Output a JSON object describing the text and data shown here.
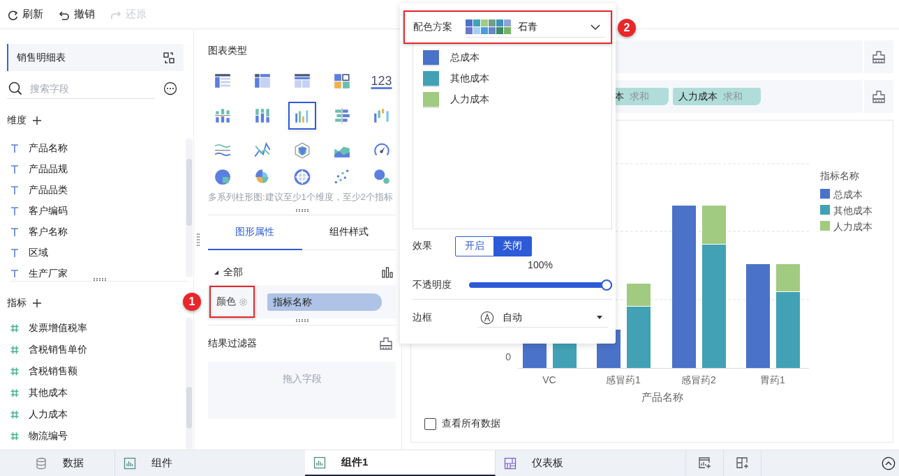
{
  "toolbar": [
    {
      "kind": "refresh",
      "label": "刷新",
      "disabled": false
    },
    {
      "kind": "undo",
      "label": "撤销",
      "disabled": false
    },
    {
      "kind": "redo",
      "label": "还原",
      "disabled": true
    }
  ],
  "data_panel": {
    "dataset": "销售明细表",
    "search": {
      "placeholder": "搜索字段"
    },
    "dimensions": {
      "title": "维度",
      "fields": [
        "产品名称",
        "产品品规",
        "产品品类",
        "客户编码",
        "客户名称",
        "区域",
        "生产厂家"
      ]
    },
    "measures": {
      "title": "指标",
      "fields": [
        "发票增值税率",
        "含税销售单价",
        "含税销售额",
        "其他成本",
        "人力成本",
        "物流编号"
      ]
    }
  },
  "chart_panel": {
    "title": "图表类型",
    "chart_types": [
      {
        "kind": "table",
        "selected": false
      },
      {
        "kind": "pivot",
        "selected": false
      },
      {
        "kind": "list",
        "selected": false
      },
      {
        "kind": "tiles",
        "selected": false
      },
      {
        "kind": "number",
        "label": "123",
        "selected": false
      },
      {
        "kind": "stacked",
        "selected": false
      },
      {
        "kind": "percent",
        "selected": false
      },
      {
        "kind": "column",
        "selected": true
      },
      {
        "kind": "mirror",
        "selected": false
      },
      {
        "kind": "waterfall",
        "selected": false
      },
      {
        "kind": "line",
        "selected": false
      },
      {
        "kind": "crossline",
        "selected": false
      },
      {
        "kind": "radar",
        "selected": false
      },
      {
        "kind": "area",
        "selected": false
      },
      {
        "kind": "gauge",
        "selected": false
      },
      {
        "kind": "pie",
        "selected": false
      },
      {
        "kind": "rose",
        "selected": false
      },
      {
        "kind": "ring",
        "selected": false
      },
      {
        "kind": "scatter",
        "selected": false
      },
      {
        "kind": "bubble",
        "selected": false
      }
    ],
    "description": "多系列柱形图:建议至少1个维度，至少2个指标",
    "tabs": [
      {
        "label": "图形属性",
        "selected": true
      },
      {
        "label": "组件样式",
        "selected": false
      }
    ],
    "group": {
      "label": "全部",
      "expanded": true
    },
    "color": {
      "label": "颜色",
      "field": "指标名称",
      "callout": "1"
    },
    "result_filter": {
      "title": "结果过滤器",
      "placeholder": "拖入字段"
    }
  },
  "measure_shelf": {
    "pills": [
      {
        "field": "本",
        "aggregation": "求和"
      },
      {
        "field": "人力成本",
        "aggregation": "求和"
      }
    ]
  },
  "chart": {
    "y_tick": "0",
    "categories": [
      "VC",
      "感冒药1",
      "感冒药2",
      "胃药1"
    ],
    "x_title": "产品名称",
    "legend": {
      "title": "指标名称",
      "items": [
        {
          "label": "总成本",
          "color": "#4a72c8"
        },
        {
          "label": "其他成本",
          "color": "#42a1b5"
        },
        {
          "label": "人力成本",
          "color": "#a1cb80"
        }
      ]
    },
    "view_all": {
      "label": "查看所有数据",
      "checked": false
    }
  },
  "color_popup": {
    "label": "配色方案",
    "scheme": "石青",
    "callout": "2",
    "palette": [
      {
        "color": "#4a72c8"
      },
      {
        "color": "#42a1b5"
      },
      {
        "color": "#a1cb80"
      },
      {
        "color": "#6f9e8c"
      },
      {
        "color": "#3f93b8"
      },
      {
        "color": "#8ea3d6"
      },
      {
        "color": "#6a78c8"
      },
      {
        "color": "#a6cff3"
      },
      {
        "color": "#4a9de0"
      },
      {
        "color": "#6589c4"
      },
      {
        "color": "#3a8a6c"
      },
      {
        "color": "#76b463"
      }
    ],
    "series": [
      {
        "label": "总成本",
        "color": "#4a72c8"
      },
      {
        "label": "其他成本",
        "color": "#42a1b5"
      },
      {
        "label": "人力成本",
        "color": "#a1cb80"
      }
    ],
    "effect": {
      "label": "效果",
      "options": [
        {
          "label": "开启",
          "selected": false
        },
        {
          "label": "关闭",
          "selected": true
        }
      ]
    },
    "opacity": {
      "label": "不透明度",
      "reading": "100%",
      "level": 1
    },
    "border": {
      "label": "边框",
      "value": "自动"
    }
  },
  "bottom_tabs": [
    {
      "kind": "data",
      "label": "数据",
      "selected": false
    },
    {
      "kind": "component",
      "label": "组件",
      "selected": false
    },
    {
      "kind": "component",
      "label": "组件1",
      "selected": true
    },
    {
      "kind": "dashboard",
      "label": "仪表板",
      "selected": false
    }
  ],
  "bottom_actions": [
    {
      "kind": "add-component"
    },
    {
      "kind": "add-dashboard"
    }
  ]
}
